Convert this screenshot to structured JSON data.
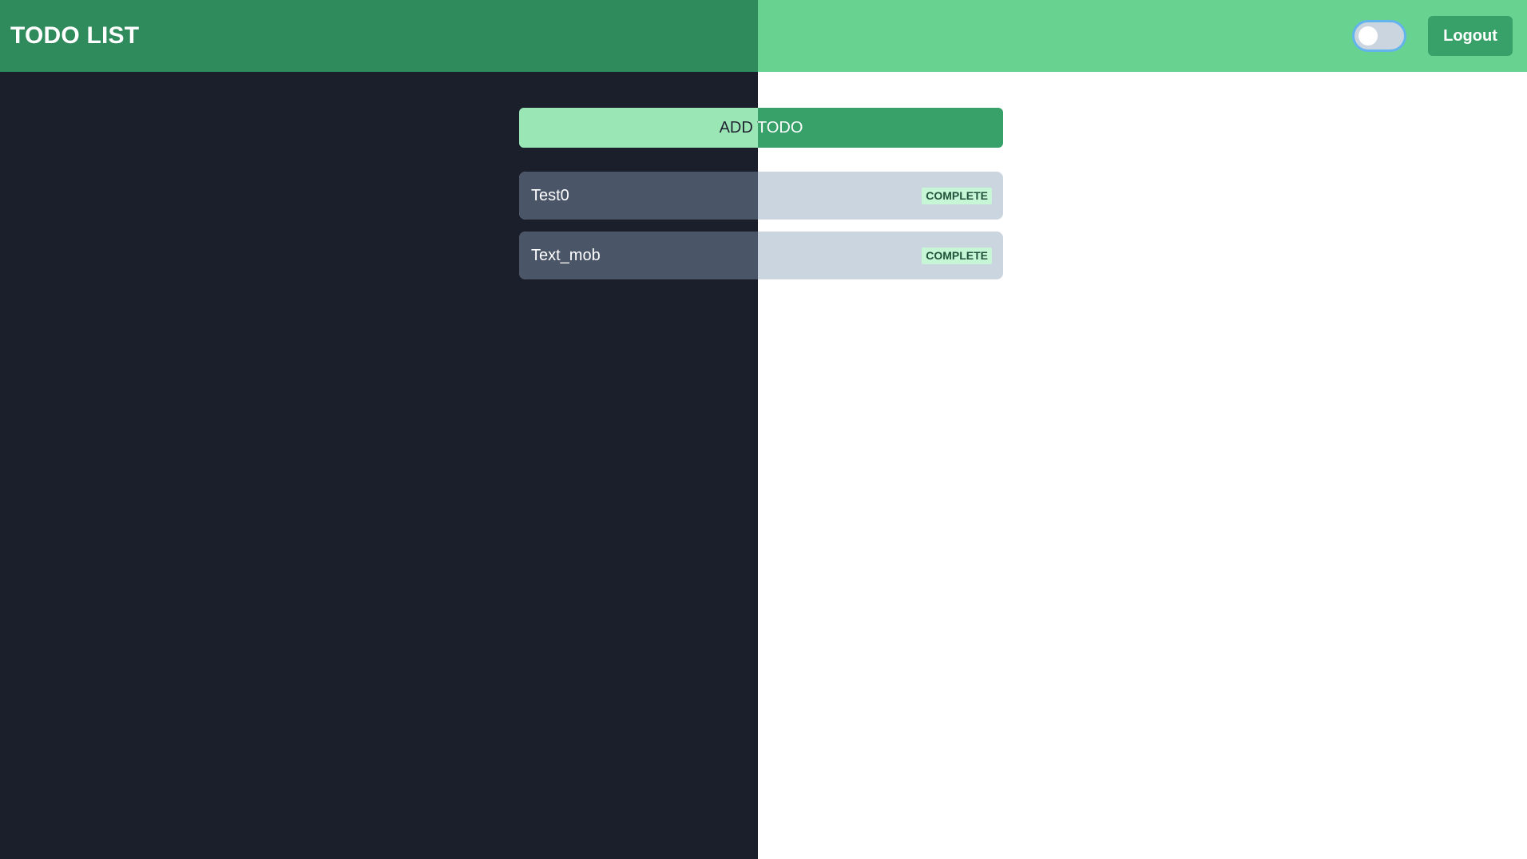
{
  "header": {
    "title": "TODO LIST",
    "logout_label": "Logout",
    "theme_toggle": {
      "checked": false,
      "icon": "toggle-switch-icon"
    }
  },
  "main": {
    "add_button_label": "ADD TODO",
    "todos": [
      {
        "text": "Test0",
        "status_label": "COMPLETE"
      },
      {
        "text": "Text_mob",
        "status_label": "COMPLETE"
      }
    ]
  },
  "colors": {
    "dark_bg": "#1b1f2b",
    "header_light": "#68d391",
    "header_dark": "#2f8a5c",
    "accent_green": "#38a169",
    "light_green": "#9ae6b4",
    "item_light": "#cbd5e0",
    "item_dark": "#4a5568",
    "badge_bg": "#c6f6d5",
    "badge_text": "#22543d"
  }
}
